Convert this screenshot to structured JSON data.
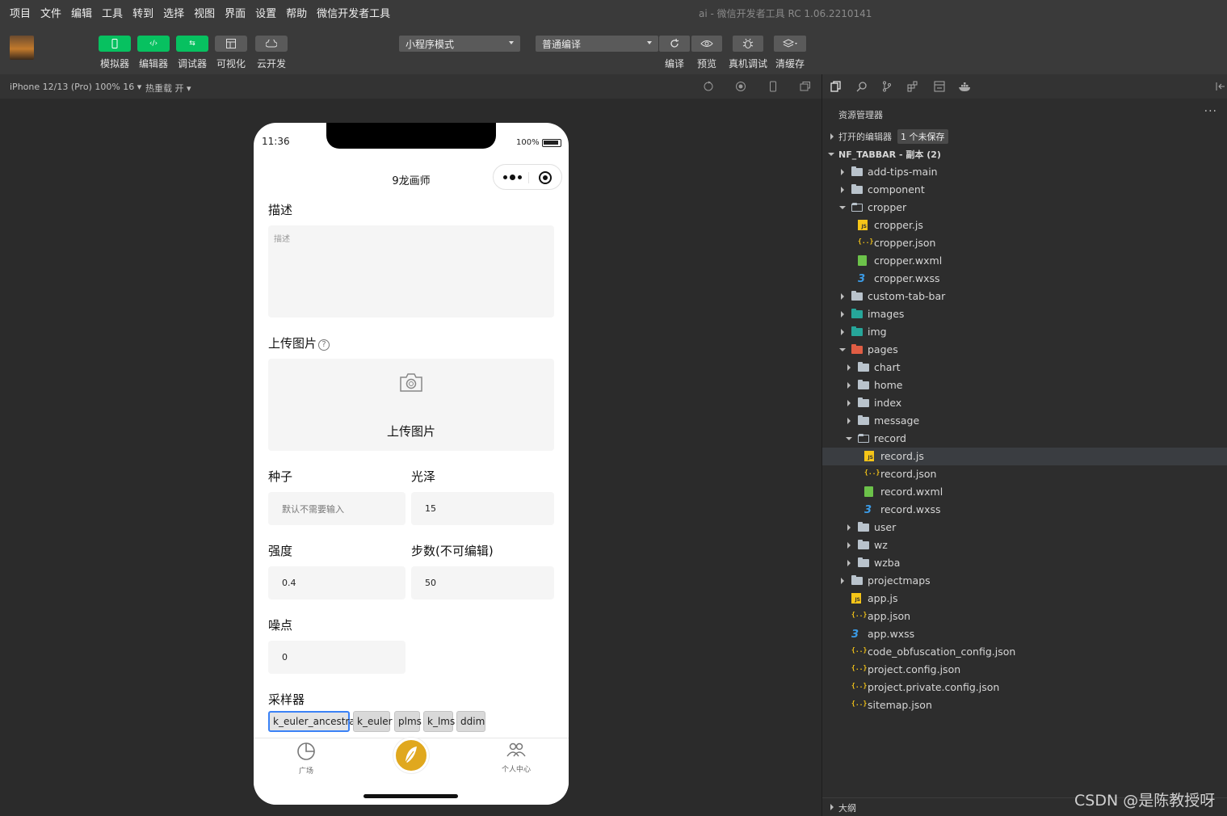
{
  "menu": {
    "items": [
      "项目",
      "文件",
      "编辑",
      "工具",
      "转到",
      "选择",
      "视图",
      "界面",
      "设置",
      "帮助",
      "微信开发者工具"
    ],
    "window_title": "ai - 微信开发者工具 RC 1.06.2210141"
  },
  "toolbar": {
    "buttons": [
      {
        "label": "模拟器",
        "icon": "phone-icon"
      },
      {
        "label": "编辑器",
        "icon": "code-icon"
      },
      {
        "label": "调试器",
        "icon": "debug-icon"
      },
      {
        "label": "可视化",
        "icon": "layout-icon"
      },
      {
        "label": "云开发",
        "icon": "cloud-icon"
      }
    ],
    "mode_select": "小程序模式",
    "compile_select": "普通编译",
    "actions": [
      "编译",
      "预览",
      "真机调试",
      "清缓存"
    ]
  },
  "simbar": {
    "device": "iPhone 12/13 (Pro) 100% 16 ▾",
    "hot_reload": "热重载 开 ▾"
  },
  "phone": {
    "time": "11:36",
    "battery": "100%",
    "nav_title": "9龙画师",
    "desc_label": "描述",
    "desc_placeholder": "描述",
    "upload_label": "上传图片",
    "upload_help": "?",
    "upload_button": "上传图片",
    "seed_label": "种子",
    "seed_placeholder": "默认不需要输入",
    "gloss_label": "光泽",
    "gloss_value": "15",
    "strength_label": "强度",
    "strength_value": "0.4",
    "steps_label": "步数(不可编辑)",
    "steps_value": "50",
    "noise_label": "噪点",
    "noise_value": "0",
    "sampler_label": "采样器",
    "samplers": [
      "k_euler_ancestral",
      "k_euler",
      "plms",
      "k_lms",
      "ddim"
    ],
    "sampler_selected": "k_euler_ancestral",
    "tabs": {
      "left": "广场",
      "right": "个人中心"
    }
  },
  "explorer": {
    "title": "资源管理器",
    "more": "···",
    "open_editors": "打开的编辑器",
    "unsaved_badge": "1 个未保存",
    "project": "NF_TABBAR - 副本 (2)",
    "tree": [
      {
        "name": "add-tips-main",
        "type": "folder",
        "depth": 1,
        "state": "closed"
      },
      {
        "name": "component",
        "type": "folder",
        "depth": 1,
        "state": "closed"
      },
      {
        "name": "cropper",
        "type": "folder",
        "depth": 1,
        "state": "open"
      },
      {
        "name": "cropper.js",
        "type": "js",
        "depth": 2
      },
      {
        "name": "cropper.json",
        "type": "json",
        "depth": 2
      },
      {
        "name": "cropper.wxml",
        "type": "wxml",
        "depth": 2
      },
      {
        "name": "cropper.wxss",
        "type": "wxss",
        "depth": 2
      },
      {
        "name": "custom-tab-bar",
        "type": "folder",
        "depth": 1,
        "state": "closed"
      },
      {
        "name": "images",
        "type": "folder-teal",
        "depth": 1,
        "state": "closed"
      },
      {
        "name": "img",
        "type": "folder-teal",
        "depth": 1,
        "state": "closed"
      },
      {
        "name": "pages",
        "type": "folder-red",
        "depth": 1,
        "state": "open"
      },
      {
        "name": "chart",
        "type": "folder",
        "depth": 2,
        "state": "closed"
      },
      {
        "name": "home",
        "type": "folder",
        "depth": 2,
        "state": "closed"
      },
      {
        "name": "index",
        "type": "folder",
        "depth": 2,
        "state": "closed"
      },
      {
        "name": "message",
        "type": "folder",
        "depth": 2,
        "state": "closed"
      },
      {
        "name": "record",
        "type": "folder",
        "depth": 2,
        "state": "open"
      },
      {
        "name": "record.js",
        "type": "js",
        "depth": 3,
        "selected": true
      },
      {
        "name": "record.json",
        "type": "json",
        "depth": 3
      },
      {
        "name": "record.wxml",
        "type": "wxml",
        "depth": 3
      },
      {
        "name": "record.wxss",
        "type": "wxss",
        "depth": 3
      },
      {
        "name": "user",
        "type": "folder",
        "depth": 2,
        "state": "closed"
      },
      {
        "name": "wz",
        "type": "folder",
        "depth": 2,
        "state": "closed"
      },
      {
        "name": "wzba",
        "type": "folder",
        "depth": 2,
        "state": "closed"
      },
      {
        "name": "projectmaps",
        "type": "folder",
        "depth": 1,
        "state": "closed"
      },
      {
        "name": "app.js",
        "type": "js",
        "depth": 1
      },
      {
        "name": "app.json",
        "type": "json",
        "depth": 1
      },
      {
        "name": "app.wxss",
        "type": "wxss",
        "depth": 1
      },
      {
        "name": "code_obfuscation_config.json",
        "type": "json",
        "depth": 1
      },
      {
        "name": "project.config.json",
        "type": "json",
        "depth": 1
      },
      {
        "name": "project.private.config.json",
        "type": "json",
        "depth": 1
      },
      {
        "name": "sitemap.json",
        "type": "json",
        "depth": 1
      }
    ],
    "outline": "大纲"
  },
  "watermark": "CSDN @是陈教授呀",
  "colors": {
    "accent_green": "#07c160",
    "fab_gold": "#e0a81e",
    "selection_blue": "#3b82f6"
  }
}
